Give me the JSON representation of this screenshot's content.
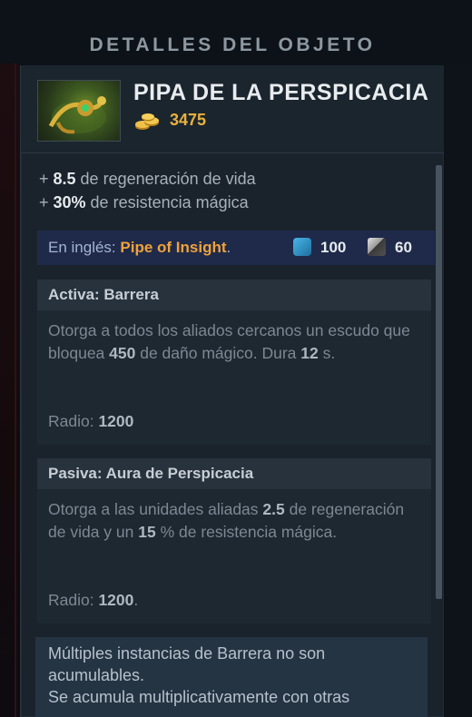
{
  "header": {
    "title": "DETALLES DEL OBJETO"
  },
  "item": {
    "name": "PIPA DE LA PERSPICACIA",
    "cost": "3475",
    "icon": "pipe-of-insight-icon"
  },
  "stats": [
    {
      "prefix": "+ ",
      "value": "8.5",
      "text": " de regeneración de vida"
    },
    {
      "prefix": "+ ",
      "value": "30%",
      "text": " de resistencia mágica"
    }
  ],
  "english": {
    "label": "En inglés: ",
    "name": "Pipe of Insight",
    "period": ".",
    "mana": "100",
    "cooldown": "60"
  },
  "active": {
    "title": "Activa: Barrera",
    "desc_parts": [
      "Otorga a todos los aliados cercanos un escudo que bloquea ",
      "450",
      " de daño mágico. Dura ",
      "12",
      " s."
    ],
    "radius_label": "Radio: ",
    "radius_value": "1200",
    "radius_suffix": ""
  },
  "passive": {
    "title": "Pasiva: Aura de Perspicacia",
    "desc_parts": [
      "Otorga a las unidades aliadas ",
      "2.5",
      " de regeneración de vida y un ",
      "15",
      " % de resistencia mágica."
    ],
    "radius_label": "Radio: ",
    "radius_value": "1200",
    "radius_suffix": "."
  },
  "note": {
    "text": "Múltiples instancias de Barrera no son acumulables.",
    "text_cut": "Se acumula multiplicativamente con otras"
  },
  "colors": {
    "gold": "#e9b13e",
    "english_name": "#f0a23b",
    "mana": "#49b6e8"
  }
}
